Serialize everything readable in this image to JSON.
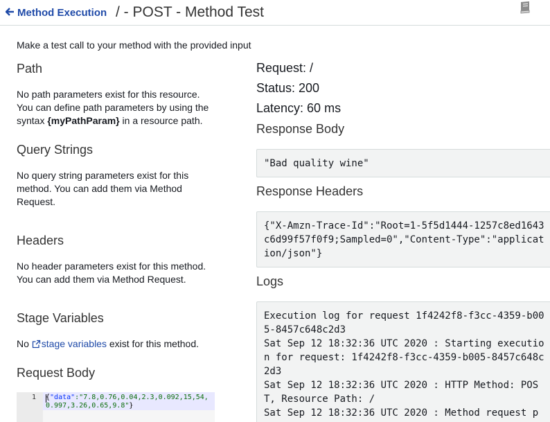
{
  "header": {
    "back_label": "Method Execution",
    "title": "/ - POST - Method Test"
  },
  "intro": "Make a test call to your method with the provided input",
  "path": {
    "heading": "Path",
    "line1": "No path parameters exist for this resource.",
    "line2": "You can define path parameters by using the",
    "line3_pre": "syntax ",
    "line3_bold": "{myPathParam}",
    "line3_post": " in a resource path."
  },
  "query": {
    "heading": "Query Strings",
    "line1": "No query string parameters exist for this",
    "line2": "method. You can add them via Method",
    "line3": "Request."
  },
  "headers": {
    "heading": "Headers",
    "line1": "No header parameters exist for this method.",
    "line2": "You can add them via Method Request."
  },
  "stage": {
    "heading": "Stage Variables",
    "pre": "No ",
    "link": "stage variables",
    "post": " exist for this method."
  },
  "request_body": {
    "heading": "Request Body",
    "line_number": "1",
    "brace_open": "{",
    "key": "\"data\"",
    "value": ":\"7.8,0.76,0.04,2.3,0.092,15,54,0.997,3.26,0.65,9.8\"",
    "brace_close": "}"
  },
  "result": {
    "request": "Request: /",
    "status": "Status: 200",
    "latency": "Latency: 60 ms",
    "response_body_heading": "Response Body",
    "response_body": "\"Bad quality wine\"",
    "response_headers_heading": "Response Headers",
    "response_headers": "{\"X-Amzn-Trace-Id\":\"Root=1-5f5d1444-1257c8ed1643c6d99f57f0f9;Sampled=0\",\"Content-Type\":\"application/json\"}",
    "logs_heading": "Logs",
    "logs": "Execution log for request 1f4242f8-f3cc-4359-b005-8457c648c2d3\nSat Sep 12 18:32:36 UTC 2020 : Starting execution for request: 1f4242f8-f3cc-4359-b005-8457c648c2d3\nSat Sep 12 18:32:36 UTC 2020 : HTTP Method: POST, Resource Path: /\nSat Sep 12 18:32:36 UTC 2020 : Method request p"
  },
  "colors": {
    "link": "#1f4aa8",
    "box_bg": "#f2f3f3",
    "json_string": "#0b6d0b",
    "json_key": "#0431fa"
  }
}
